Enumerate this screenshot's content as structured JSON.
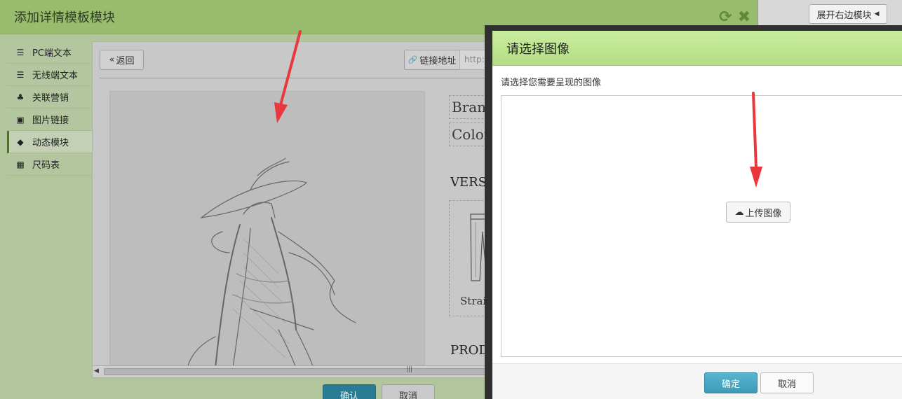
{
  "background_page": {
    "expand_button_label": "展开右边模块",
    "expand_icon": "caret-left-icon"
  },
  "template_modal": {
    "title": "添加详情模板模块",
    "header_icons": [
      "refresh-icon",
      "close-icon"
    ],
    "sidebar": {
      "items": [
        {
          "label": "PC端文本",
          "icon": "align-left-icon"
        },
        {
          "label": "无线端文本",
          "icon": "align-left-icon"
        },
        {
          "label": "关联营销",
          "icon": "sitemap-icon"
        },
        {
          "label": "图片链接",
          "icon": "picture-icon"
        },
        {
          "label": "动态模块",
          "icon": "tag-icon",
          "active": true
        },
        {
          "label": "尺码表",
          "icon": "table-icon"
        }
      ]
    },
    "toolbar": {
      "back_label": "返回",
      "link_label": "链接地址",
      "link_placeholder": "http://"
    },
    "preview": {
      "brand_text": "Brand:",
      "color_text": "Color:",
      "version_heading": "VERSIO",
      "version_item_label": "Straig",
      "product_heading": "PRODU"
    },
    "footer": {
      "ok_label": "确认",
      "cancel_label": "取消"
    }
  },
  "image_modal": {
    "title": "请选择图像",
    "instruction": "请选择您需要呈现的图像",
    "upload_label": "上传图像",
    "upload_icon": "cloud-upload-icon",
    "ok_label": "确定",
    "cancel_label": "取消"
  },
  "colors": {
    "template_header": "#98bc6e",
    "image_header": "#c3e89a",
    "primary_button": "#3fa0bd",
    "annotation_arrow": "#e8383d"
  }
}
